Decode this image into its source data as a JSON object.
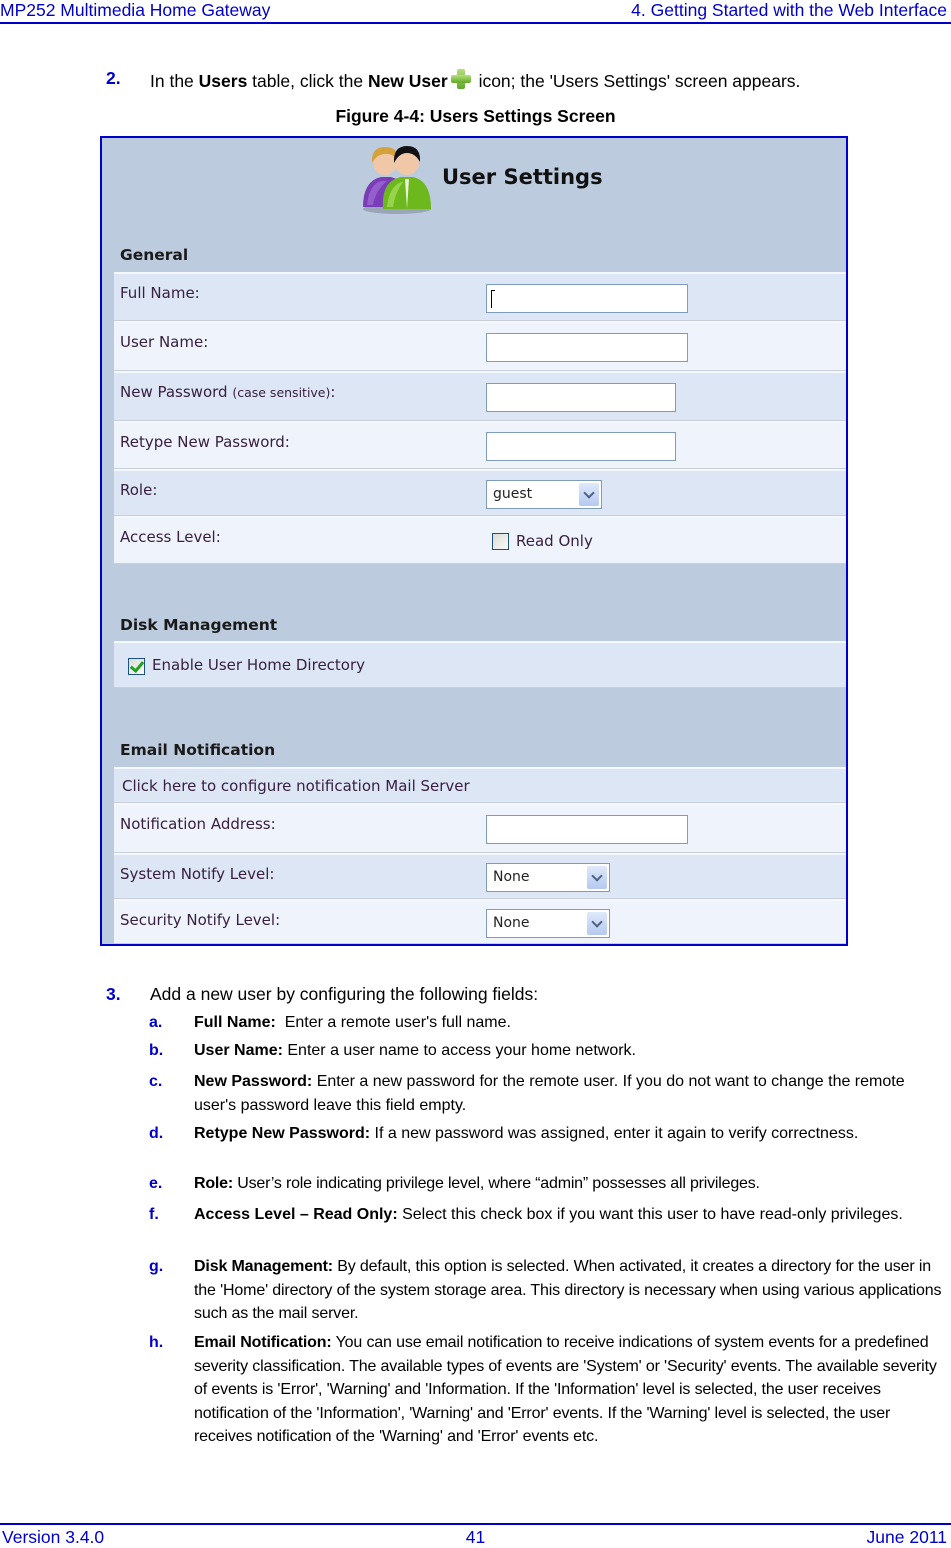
{
  "header": {
    "left": "MP252 Multimedia Home Gateway",
    "right": "4. Getting Started with the Web Interface"
  },
  "step2": {
    "num": "2.",
    "pre": "In the ",
    "b1": "Users",
    "mid": " table, click the ",
    "b2": "New User",
    "post": " icon; the 'Users Settings' screen appears."
  },
  "figure": {
    "caption": "Figure 4-4: Users Settings Screen"
  },
  "screen": {
    "title": "User Settings",
    "sections": {
      "general": "General",
      "disk": "Disk Management",
      "email": "Email Notification"
    },
    "fields": {
      "full_name": {
        "label": "Full Name:",
        "value": ""
      },
      "user_name": {
        "label": "User Name:",
        "value": ""
      },
      "new_password": {
        "label": "New Password",
        "hint": "(case sensitive)",
        "suffix": ":",
        "value": ""
      },
      "retype_password": {
        "label": "Retype New Password:",
        "value": ""
      },
      "role": {
        "label": "Role:",
        "value": "guest"
      },
      "access_level": {
        "label": "Access Level:",
        "option": "Read Only",
        "checked": false
      },
      "home_dir": {
        "label": "Enable User Home Directory",
        "checked": true
      },
      "mail_server_link": "Click here to configure notification Mail Server",
      "notification_address": {
        "label": "Notification Address:",
        "value": ""
      },
      "system_notify": {
        "label": "System Notify Level:",
        "value": "None"
      },
      "security_notify": {
        "label": "Security Notify Level:",
        "value": "None"
      }
    }
  },
  "step3": {
    "num": "3.",
    "text": "Add a new user by configuring the following fields:",
    "items": [
      {
        "key": "a.",
        "term": "Full Name:",
        "desc": "  Enter a remote user's full name."
      },
      {
        "key": "b.",
        "term": "User Name:",
        "desc": " Enter a user name to access your home network."
      },
      {
        "key": "c.",
        "term": "New Password:",
        "desc": " Enter a new password for the remote user. If you do not want to change the remote user's password leave this field empty."
      },
      {
        "key": "d.",
        "term": "Retype New Password:",
        "desc": " If a new password was assigned, enter it again to verify correctness."
      },
      {
        "key": "e.",
        "term": "Role:",
        "desc": " User’s role indicating privilege level, where “admin” possesses all privileges."
      },
      {
        "key": "f.",
        "term": "Access Level – Read Only:",
        "desc": " Select this check box if you want this user to have read-only privileges."
      },
      {
        "key": "g.",
        "term": "Disk Management:",
        "desc": " By default, this option is selected. When activated, it creates a directory for the user in the 'Home' directory of the system storage area. This directory is necessary when using various applications such as the mail server."
      },
      {
        "key": "h.",
        "term": "Email Notification:",
        "desc": " You can use email notification to receive indications of system events for a predefined severity classification. The available types of events are 'System' or 'Security' events. The available severity of events is 'Error', 'Warning' and 'Information. If the 'Information' level is selected, the user receives notification of the 'Information', 'Warning' and 'Error' events. If the 'Warning' level is selected, the user receives notification of the 'Warning' and 'Error' events etc."
      }
    ]
  },
  "footer": {
    "version": "Version 3.4.0",
    "page": "41",
    "date": "June 2011"
  }
}
